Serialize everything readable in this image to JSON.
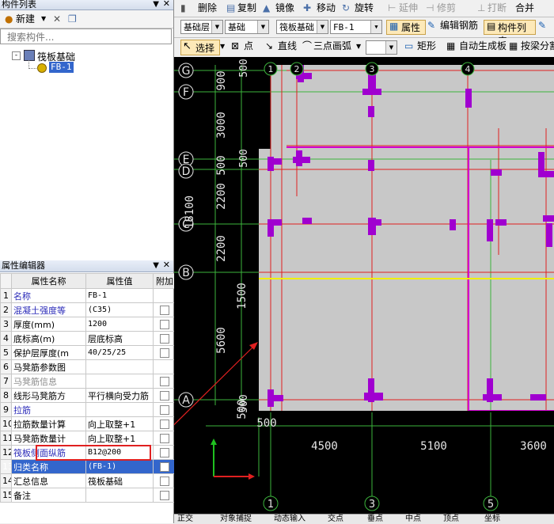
{
  "left_panel": {
    "components_title": "构件列表",
    "new_label": "新建",
    "search_placeholder": "搜索构件...",
    "tree_root": "筏板基础",
    "tree_child": "FB-1"
  },
  "property_editor": {
    "title": "属性编辑器",
    "headers": [
      "属性名称",
      "属性值",
      "附加"
    ],
    "rows": [
      {
        "num": "1",
        "name": "名称",
        "value": "FB-1",
        "style": "blue",
        "checkbox": false
      },
      {
        "num": "2",
        "name": "混凝土强度等",
        "value": "(C35)",
        "style": "blue",
        "checkbox": true
      },
      {
        "num": "3",
        "name": "厚度(mm)",
        "value": "1200",
        "style": "",
        "checkbox": true
      },
      {
        "num": "4",
        "name": "底标高(m)",
        "value": "层底标高",
        "style": "",
        "checkbox": true
      },
      {
        "num": "5",
        "name": "保护层厚度(m",
        "value": "40/25/25",
        "style": "",
        "checkbox": true
      },
      {
        "num": "6",
        "name": "马凳筋参数图",
        "value": "",
        "style": "",
        "checkbox": false
      },
      {
        "num": "7",
        "name": "马凳筋信息",
        "value": "",
        "style": "gray",
        "checkbox": true
      },
      {
        "num": "8",
        "name": "线形马凳筋方",
        "value": "平行横向受力筋",
        "style": "",
        "checkbox": true
      },
      {
        "num": "9",
        "name": "拉筋",
        "value": "",
        "style": "blue",
        "checkbox": true
      },
      {
        "num": "10",
        "name": "拉筋数量计算",
        "value": "向上取整+1",
        "style": "",
        "checkbox": true
      },
      {
        "num": "11",
        "name": "马凳筋数量计",
        "value": "向上取整+1",
        "style": "",
        "checkbox": true
      },
      {
        "num": "12",
        "name": "筏板侧面纵筋",
        "value": "B12@200",
        "style": "blue",
        "checkbox": true
      },
      {
        "num": "13",
        "name": "归类名称",
        "value": "(FB-1)",
        "style": "selected",
        "checkbox": true
      },
      {
        "num": "14",
        "name": "汇总信息",
        "value": "筏板基础",
        "style": "",
        "checkbox": true
      },
      {
        "num": "15",
        "name": "备注",
        "value": "",
        "style": "",
        "checkbox": true
      }
    ]
  },
  "toolbar1": {
    "delete": "删除",
    "copy": "复制",
    "mirror": "镜像",
    "move": "移动",
    "rotate": "旋转",
    "extend": "延伸",
    "trim": "修剪",
    "break": "打断",
    "merge": "合并"
  },
  "toolbar2": {
    "layer": "基础层",
    "category": "基础",
    "type": "筏板基础",
    "item": "FB-1",
    "properties": "属性",
    "edit_rebar": "编辑钢筋",
    "component_list": "构件列表"
  },
  "toolbar3": {
    "select": "选择",
    "point": "点",
    "line": "直线",
    "arc": "三点画弧",
    "rect": "矩形",
    "auto_generate": "自动生成板",
    "by_beam": "按梁分割"
  },
  "drawing": {
    "row_axes": [
      "G",
      "F",
      "E",
      "D",
      "C",
      "B",
      "A"
    ],
    "top_axes": [
      "1",
      "2",
      "3",
      "4"
    ],
    "bottom_axes": [
      "1",
      "3",
      "5"
    ],
    "left_dims": [
      "900",
      "3000",
      "500",
      "2200",
      "18100",
      "2200",
      "1500",
      "5600",
      "500"
    ],
    "top_left_dims": [
      "500",
      "500",
      "500"
    ],
    "bottom_dims": [
      "500",
      "4500",
      "5100",
      "3600"
    ]
  },
  "status": {
    "items": [
      "正交",
      "对象捕捉",
      "动态输入",
      "交点",
      "垂点",
      "中点",
      "顶点",
      "坐标"
    ]
  },
  "colors": {
    "canvas_bg": "#000000",
    "slab_fill": "#c8c8c8",
    "column": "#a000d0",
    "axis_line": "#3cb43c",
    "red_line": "#e02020",
    "yellow_line": "#f0f000",
    "highlight_box": "#e02020"
  }
}
